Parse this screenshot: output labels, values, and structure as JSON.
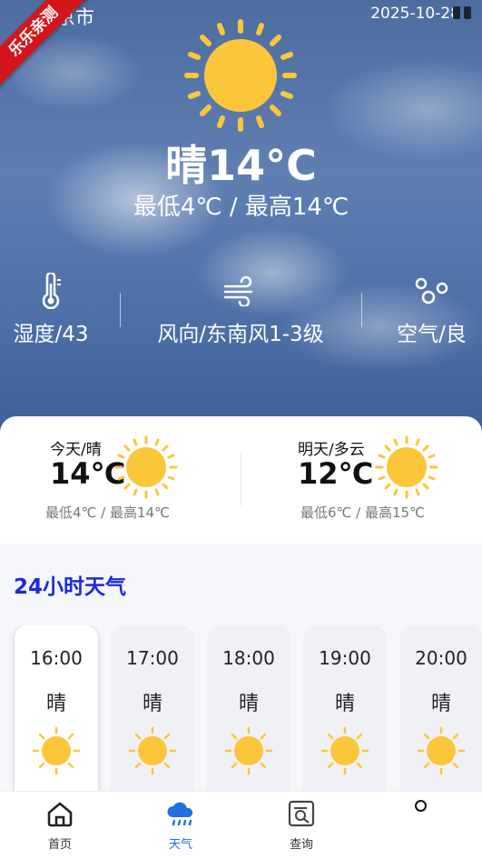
{
  "ribbon": {
    "text": "乐乐亲测"
  },
  "header": {
    "city": "京市",
    "date": "2025-10-28"
  },
  "current": {
    "temp_text": "晴14°C",
    "range_text": "最低4℃  /  最高14℃",
    "icon": "sun-icon"
  },
  "metrics": [
    {
      "icon": "thermometer-icon",
      "label": "湿度/43"
    },
    {
      "icon": "wind-icon",
      "label": "风向/东南风1-3级"
    },
    {
      "icon": "air-bubbles-icon",
      "label": "空气/良"
    }
  ],
  "forecast": [
    {
      "name": "今天/晴",
      "temp": "14℃",
      "range": "最低4℃ / 最高14℃",
      "icon": "sun-icon"
    },
    {
      "name": "明天/多云",
      "temp": "12℃",
      "range": "最低6℃ / 最高15℃",
      "icon": "sun-icon"
    }
  ],
  "hourly": {
    "title": "24小时天气",
    "items": [
      {
        "time": "16:00",
        "cond": "晴",
        "icon": "sun-icon"
      },
      {
        "time": "17:00",
        "cond": "晴",
        "icon": "sun-icon"
      },
      {
        "time": "18:00",
        "cond": "晴",
        "icon": "sun-icon"
      },
      {
        "time": "19:00",
        "cond": "晴",
        "icon": "sun-icon"
      },
      {
        "time": "20:00",
        "cond": "晴",
        "icon": "sun-icon"
      }
    ]
  },
  "tabs": [
    {
      "label": "首页",
      "icon": "home-icon"
    },
    {
      "label": "天气",
      "icon": "cloud-rain-icon",
      "active": true
    },
    {
      "label": "查询",
      "icon": "search-doc-icon"
    }
  ],
  "colors": {
    "accent": "#1f6fe0",
    "sun": "#fcc63a",
    "title": "#1b28e0",
    "ribbon": "#d4161c"
  }
}
